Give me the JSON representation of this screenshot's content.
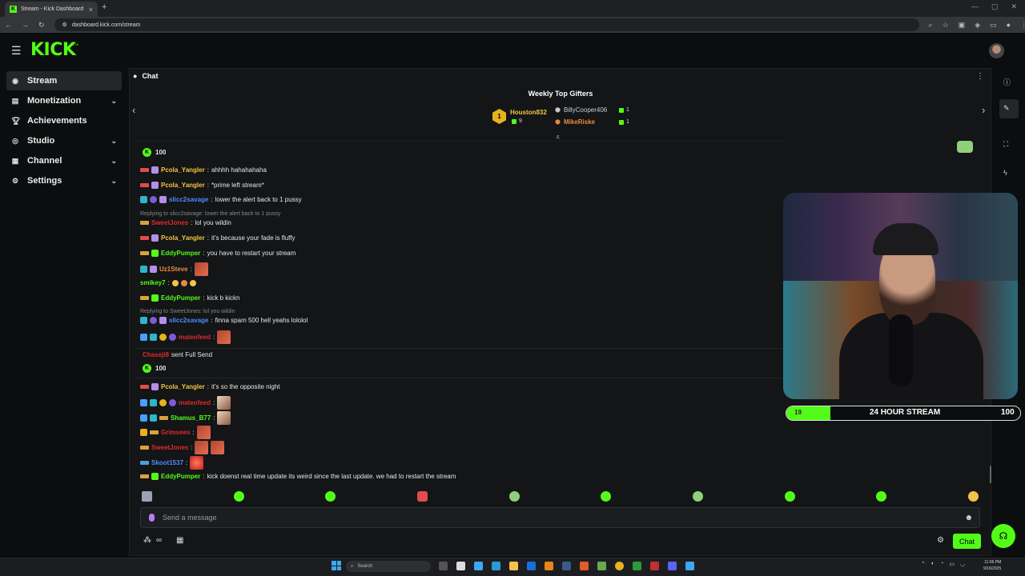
{
  "browser": {
    "tab_title": "Stream - Kick Dashboard",
    "tab_favicon": "K",
    "tab_close": "×",
    "new_tab": "+",
    "url": "dashboard.kick.com/stream"
  },
  "app": {
    "logo": "KICK",
    "logo_badge": "BETA",
    "accent": "#53fc18"
  },
  "sidebar": {
    "items": [
      {
        "label": "Stream",
        "icon": "radio-icon",
        "active": true
      },
      {
        "label": "Monetization",
        "icon": "wallet-icon",
        "expandable": true
      },
      {
        "label": "Achievements",
        "icon": "trophy-icon"
      },
      {
        "label": "Studio",
        "icon": "studio-icon",
        "expandable": true
      },
      {
        "label": "Channel",
        "icon": "channel-icon",
        "expandable": true
      },
      {
        "label": "Settings",
        "icon": "gear-icon",
        "expandable": true
      }
    ]
  },
  "chat": {
    "title": "Chat",
    "gifters": {
      "title": "Weekly Top Gifters",
      "first": {
        "rank": "1",
        "name": "Houston832",
        "count": "9"
      },
      "second": {
        "name": "BillyCooper406",
        "count": "1"
      },
      "third": {
        "name": "MikeRiske",
        "count": "1"
      }
    },
    "kicks_top": "100",
    "messages": [
      {
        "user": "Pcola_Yangler",
        "color": "#f5c542",
        "text": "ahhhh hahahahaha"
      },
      {
        "user": "Pcola_Yangler",
        "color": "#f5c542",
        "text": "*prime left stream*"
      },
      {
        "user": "slicc2savage",
        "color": "#4c8dff",
        "text": "lower the alert back to 1 pussy"
      },
      {
        "reply": "Replying to slicc2savage: lower the alert back to 1 pussy"
      },
      {
        "user": "SweetJones",
        "color": "#e02a2a",
        "text": "lol you wildin"
      },
      {
        "user": "Pcola_Yangler",
        "color": "#f5c542",
        "text": "it's because your fade is fluffy"
      },
      {
        "user": "EddyPumper",
        "color": "#53fc18",
        "text": "you have to restart your stream"
      },
      {
        "user": "Uz1Steve",
        "color": "#f08a3c",
        "text": ""
      },
      {
        "user": "smikey7",
        "color": "#53fc18",
        "text": ""
      },
      {
        "user": "EddyPumper",
        "color": "#53fc18",
        "text": "kick b kickn"
      },
      {
        "reply": "Replying to SweetJones: lol you wildin"
      },
      {
        "user": "slicc2savage",
        "color": "#4c8dff",
        "text": "finna spam 500 hell yeahs lololol"
      },
      {
        "user": "mateofeed",
        "color": "#e02a2a",
        "text": ""
      }
    ],
    "gift_event": {
      "user": "Chaseji8",
      "text": "sent Full Send",
      "amount": "100"
    },
    "messages2": [
      {
        "user": "Pcola_Yangler",
        "color": "#f5c542",
        "text": "it's so the opposite night"
      },
      {
        "user": "mateofeed",
        "color": "#e02a2a",
        "text": ""
      },
      {
        "user": "Shamus_B77",
        "color": "#53fc18",
        "text": ""
      },
      {
        "user": "Grimsees",
        "color": "#e02a2a",
        "text": ""
      },
      {
        "user": "SweetJones",
        "color": "#e02a2a",
        "text": ""
      },
      {
        "user": "Skoot1537",
        "color": "#4c8dff",
        "text": ""
      },
      {
        "user": "EddyPumper",
        "color": "#53fc18",
        "text": "kick doenst real time update its weird since the last update. we had to restart the stream"
      }
    ],
    "input_placeholder": "Send a message",
    "send_label": "Chat",
    "points_symbol": "∞"
  },
  "goal": {
    "current": "19",
    "label": "24 HOUR STREAM",
    "target": "100",
    "progress_fraction": 0.19
  },
  "taskbar": {
    "search_placeholder": "Search",
    "time": "11:06 PM",
    "date": "9/16/2025"
  }
}
